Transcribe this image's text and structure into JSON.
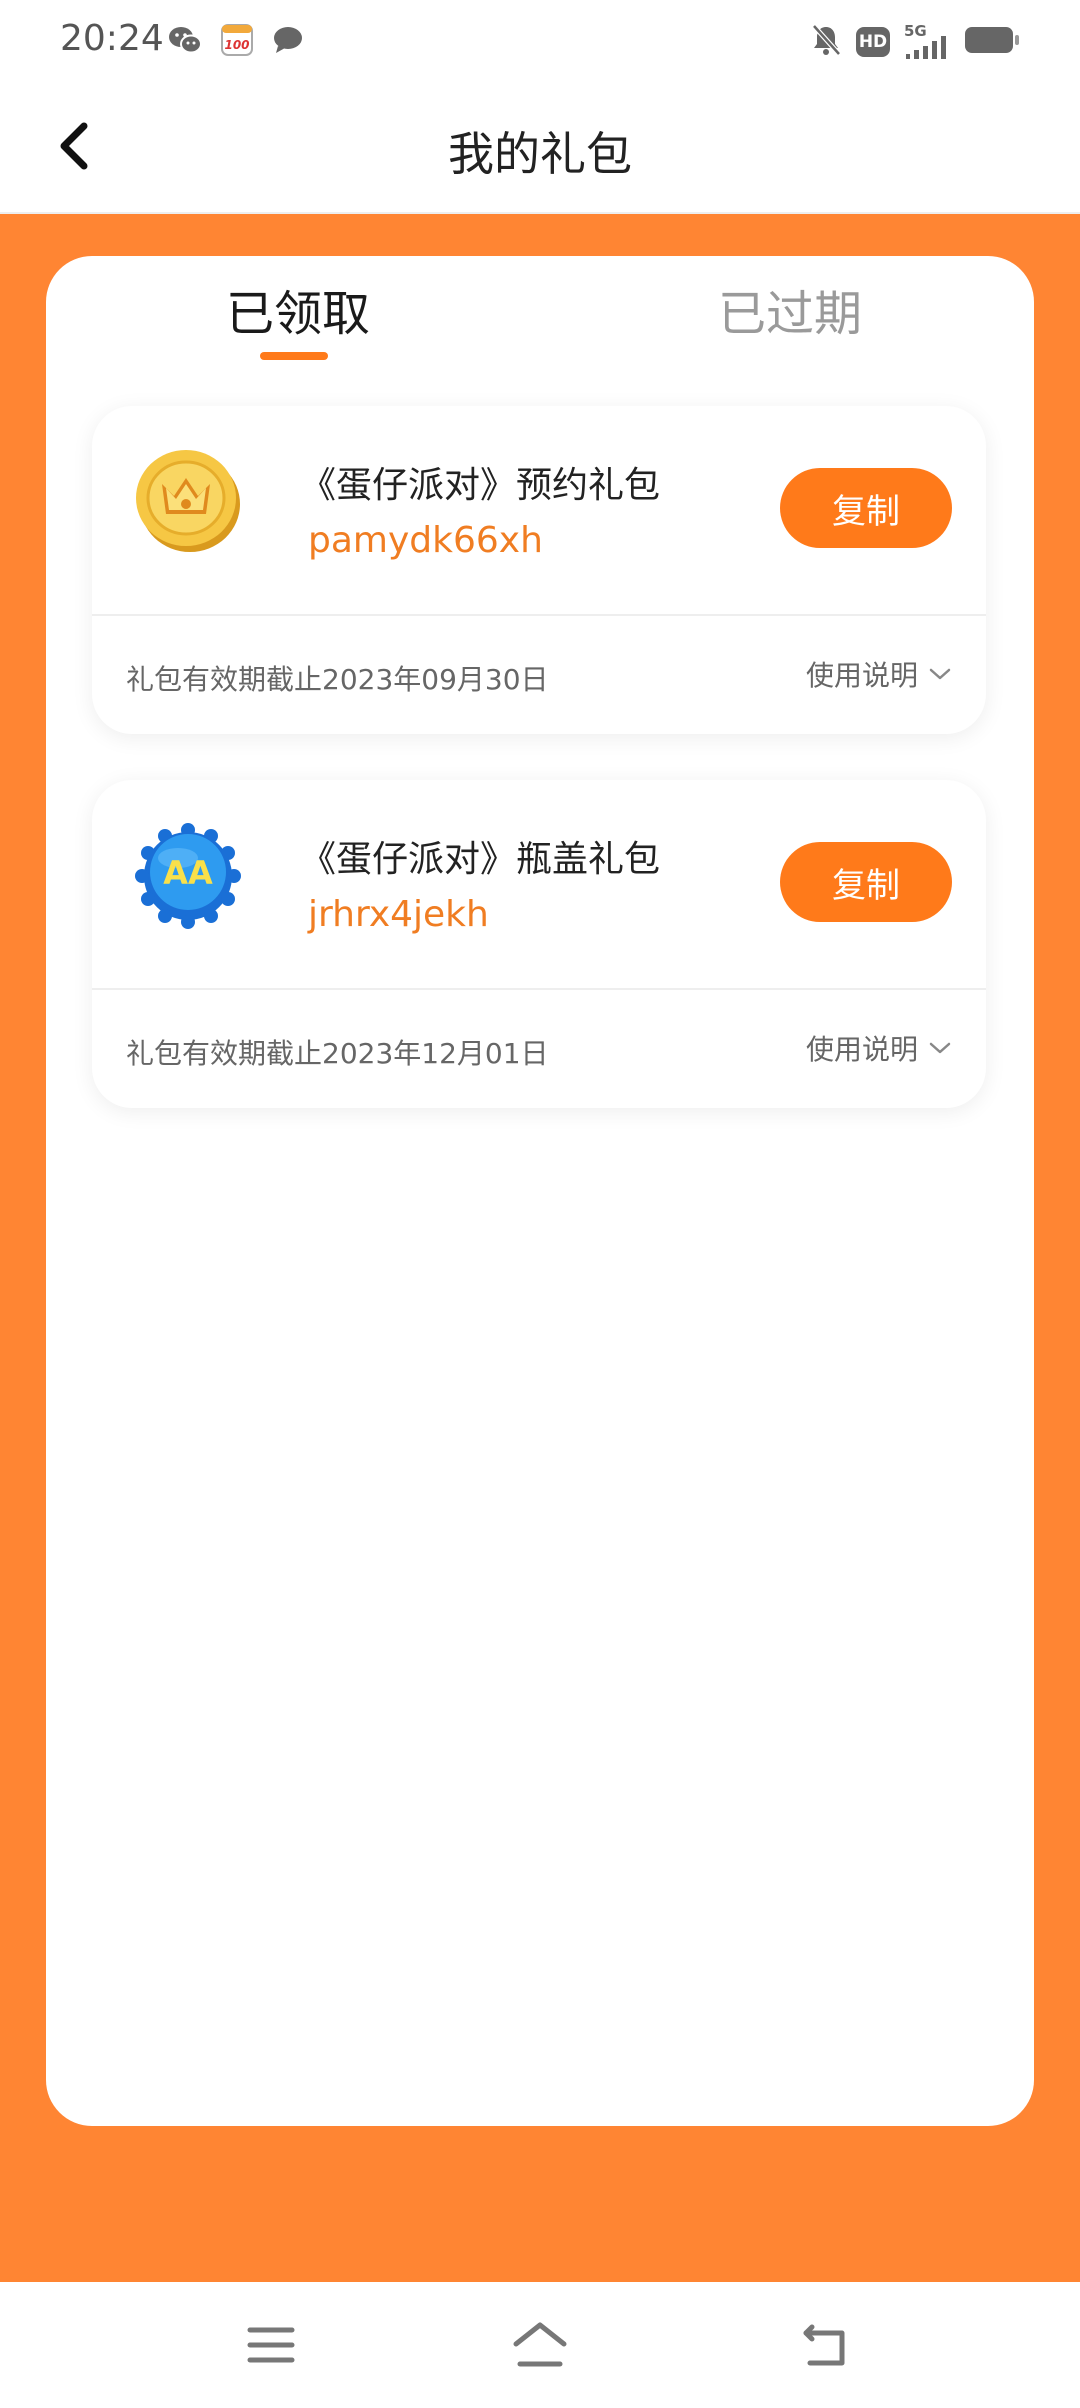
{
  "status_bar": {
    "time": "20:24",
    "left_icons": [
      "wechat-icon",
      "calendar-100-icon",
      "message-icon"
    ],
    "right_icons": [
      "mute-bell-icon",
      "hd-icon",
      "signal-5g-icon",
      "battery-icon"
    ],
    "hd_label": "HD",
    "network_label": "5G"
  },
  "header": {
    "title": "我的礼包"
  },
  "tabs": [
    {
      "label": "已领取",
      "active": true
    },
    {
      "label": "已过期",
      "active": false
    }
  ],
  "gifts": [
    {
      "name": "《蛋仔派对》预约礼包",
      "code": "pamydk66xh",
      "copy_label": "复制",
      "expiry": "礼包有效期截止2023年09月30日",
      "usage_label": "使用说明",
      "icon": "crown-coin-icon"
    },
    {
      "name": "《蛋仔派对》瓶盖礼包",
      "code": "jrhrx4jekh",
      "copy_label": "复制",
      "expiry": "礼包有效期截止2023年12月01日",
      "usage_label": "使用说明",
      "icon": "bottle-cap-icon"
    }
  ],
  "bottom_nav": [
    "menu-icon",
    "home-icon",
    "back-icon"
  ],
  "colors": {
    "accent": "#FF7A1A",
    "background": "#FF8533",
    "code_text": "#F07D22"
  }
}
